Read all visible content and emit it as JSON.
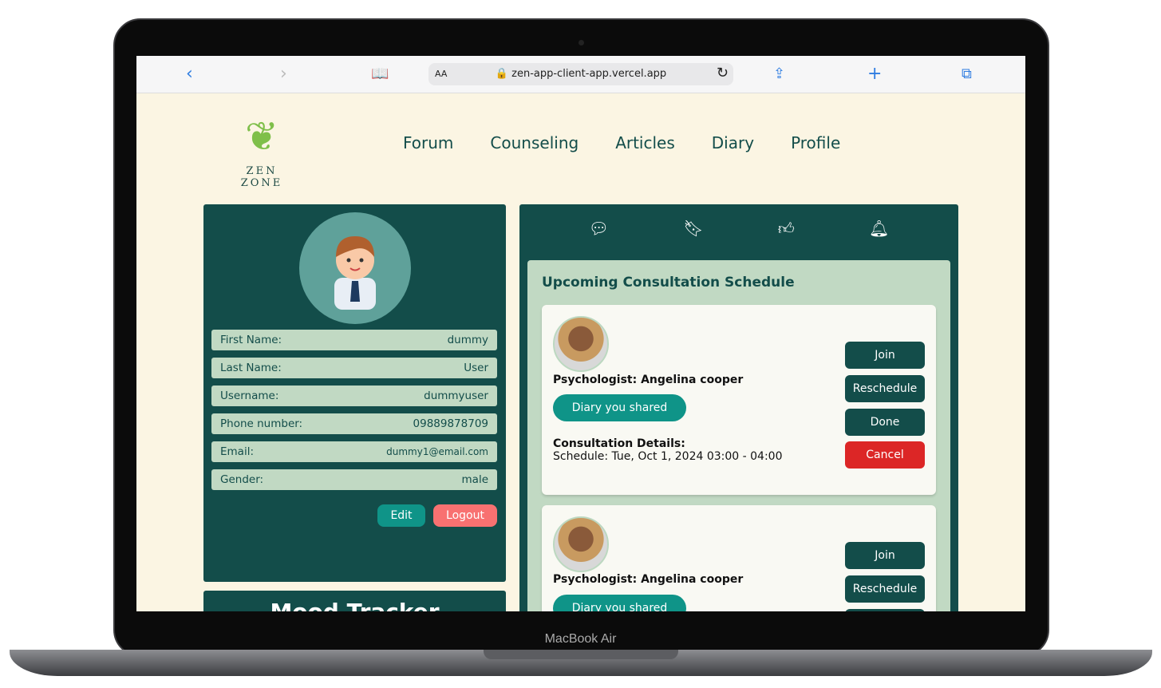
{
  "device": {
    "label": "MacBook Air"
  },
  "browser": {
    "text_size": "AA",
    "url": "zen-app-client-app.vercel.app"
  },
  "logo": {
    "text": "ZEN ZONE"
  },
  "nav": [
    "Forum",
    "Counseling",
    "Articles",
    "Diary",
    "Profile"
  ],
  "profile": {
    "fields": [
      {
        "label": "First Name:",
        "value": "dummy"
      },
      {
        "label": "Last Name:",
        "value": "User"
      },
      {
        "label": "Username:",
        "value": "dummyuser"
      },
      {
        "label": "Phone number:",
        "value": "09889878709"
      },
      {
        "label": "Email:",
        "value": "dummy1@email.com"
      },
      {
        "label": "Gender:",
        "value": "male"
      }
    ],
    "edit": "Edit",
    "logout": "Logout"
  },
  "mood": {
    "title": "Mood Tracker"
  },
  "schedule": {
    "title": "Upcoming Consultation Schedule",
    "cards": [
      {
        "psychologist": "Psychologist: Angelina cooper",
        "diary": "Diary you shared",
        "details_label": "Consultation Details:",
        "schedule": "Schedule: Tue, Oct 1, 2024 03:00 - 04:00"
      },
      {
        "psychologist": "Psychologist: Angelina cooper",
        "diary": "Diary you shared"
      }
    ],
    "buttons": {
      "join": "Join",
      "reschedule": "Reschedule",
      "done": "Done",
      "cancel": "Cancel"
    }
  },
  "colors": {
    "primary": "#134d4a",
    "accent": "#0f9488",
    "cancel": "#dc2626",
    "logout": "#f87171",
    "panel": "#c1d9c3"
  }
}
